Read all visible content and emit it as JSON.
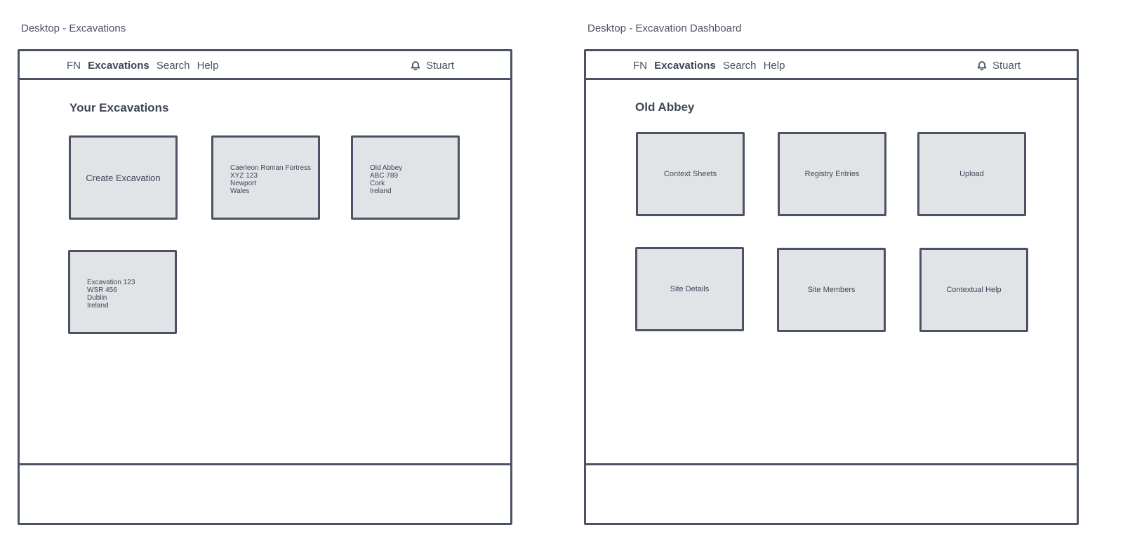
{
  "frames": [
    {
      "label": "Desktop - Excavations",
      "nav": {
        "brand": "FN",
        "active": "Excavations",
        "search": "Search",
        "help": "Help",
        "user": "Stuart"
      },
      "title": "Your Excavations",
      "create_label": "Create Excavation",
      "excavations": [
        {
          "lines": [
            "Caerleon Roman Fortress",
            "XYZ 123",
            "Newport",
            "Wales"
          ]
        },
        {
          "lines": [
            "Old Abbey",
            "ABC 789",
            "Cork",
            "Ireland"
          ]
        },
        {
          "lines": [
            "Excavation 123",
            "WSR 456",
            "Dublin",
            "Ireland"
          ]
        }
      ]
    },
    {
      "label": "Desktop - Excavation Dashboard",
      "nav": {
        "brand": "FN",
        "active": "Excavations",
        "search": "Search",
        "help": "Help",
        "user": "Stuart"
      },
      "title": "Old Abbey",
      "tiles": [
        "Context Sheets",
        "Registry Entries",
        "Upload",
        "Site Details",
        "Site Members",
        "Contextual Help"
      ]
    }
  ],
  "icons": {
    "notifications": "bell-icon"
  },
  "colors": {
    "stroke": "#4a5264",
    "card_fill": "#e1e3e7",
    "text": "#4b5263"
  }
}
